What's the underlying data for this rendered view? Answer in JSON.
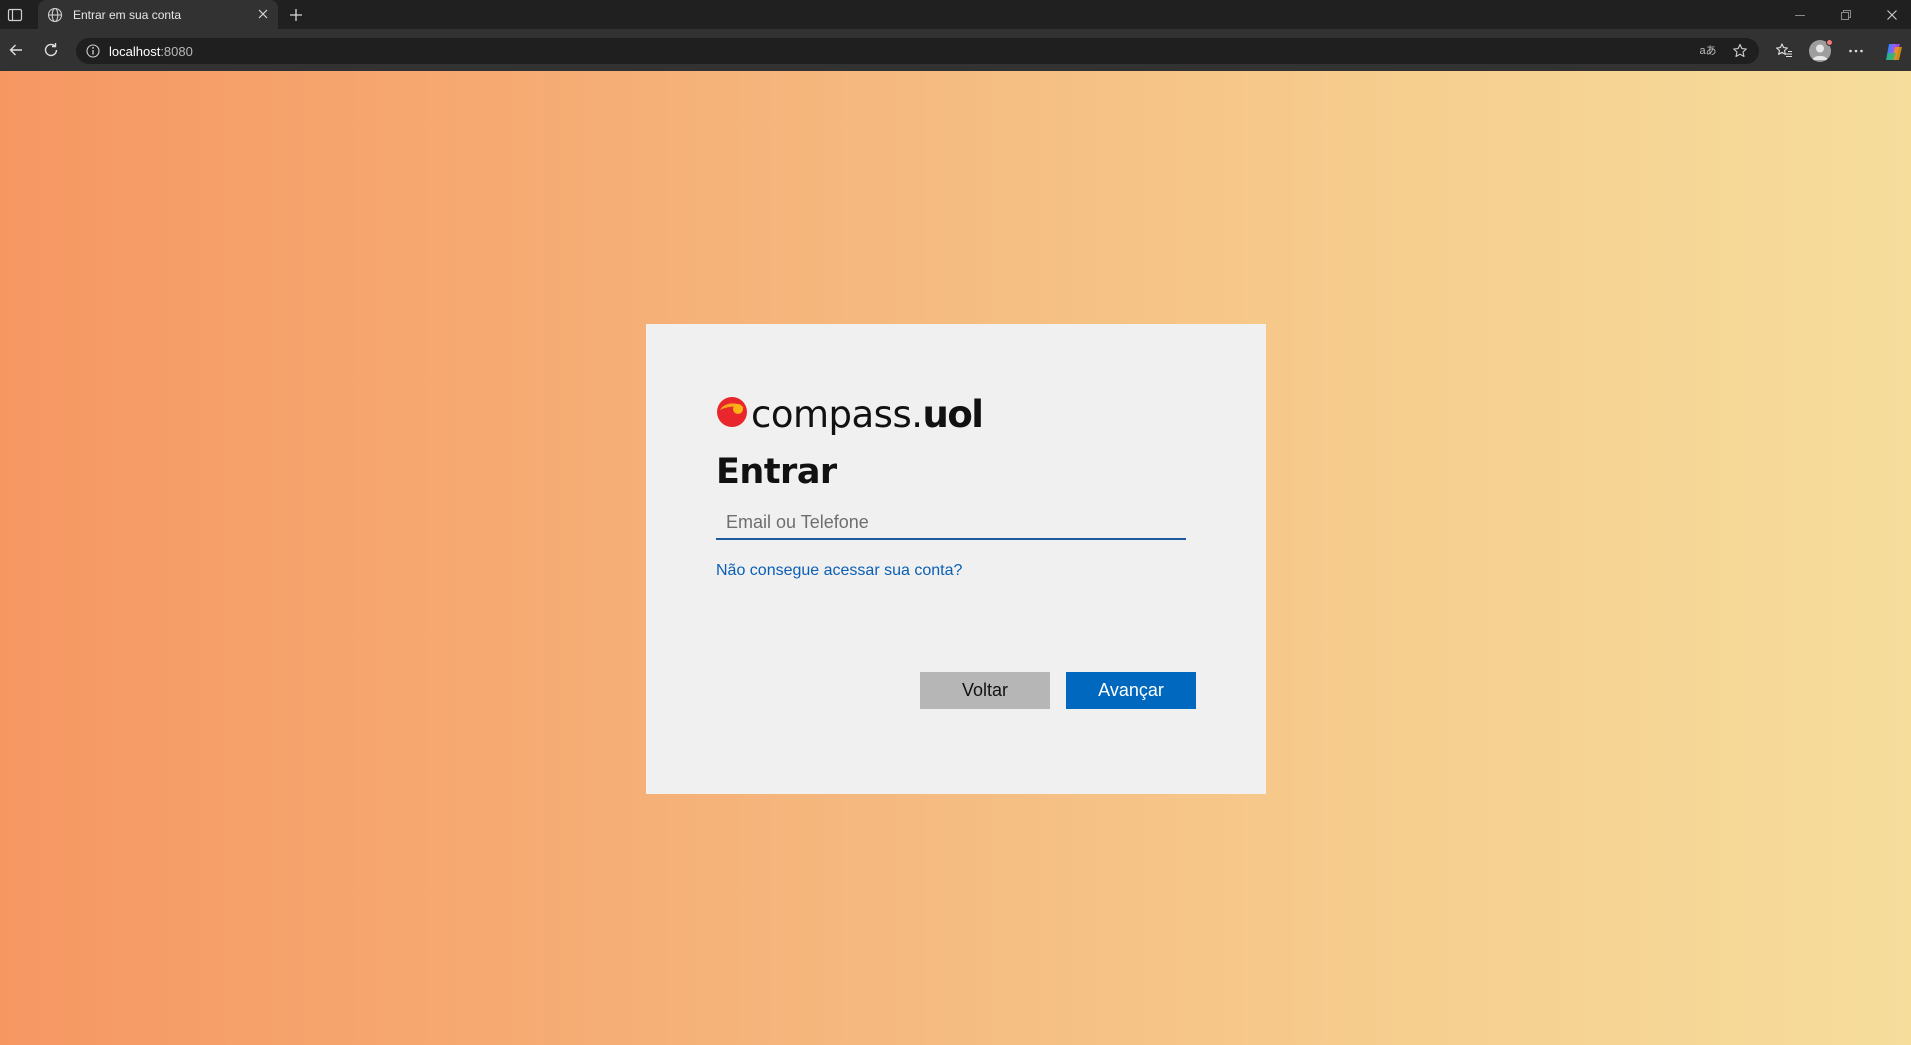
{
  "browser": {
    "tab_title": "Entrar em sua conta",
    "url_host": "localhost",
    "url_port": ":8080",
    "read_aloud_glyph": "aあ",
    "icons": {
      "tab_actions": "tab-actions-icon",
      "favicon": "globe-icon",
      "tab_close": "close-icon",
      "new_tab": "plus-icon",
      "back": "back-arrow-icon",
      "refresh": "refresh-icon",
      "site_info": "info-icon",
      "favorite": "star-icon",
      "favorites": "favorites-icon",
      "profile": "profile-icon",
      "menu": "more-icon",
      "copilot": "copilot-icon",
      "minimize": "minimize-icon",
      "restore": "restore-icon",
      "close_window": "close-icon"
    }
  },
  "page": {
    "logo": {
      "word_main": "compass",
      "word_dot": ".",
      "word_bold": "uol",
      "mark_colors": [
        "#e8262c",
        "#f7a51c",
        "#fcd34d"
      ]
    },
    "title": "Entrar",
    "email_input": {
      "value": "",
      "placeholder": "Email ou Telefone"
    },
    "help_link": "Não consegue acessar sua conta?",
    "buttons": {
      "back_label": "Voltar",
      "next_label": "Avançar"
    },
    "colors": {
      "primary": "#0068be",
      "link": "#0a5fb6",
      "secondary_button": "#b6b6b6",
      "card": "#f0f0f0",
      "gradient_start": "#f69762",
      "gradient_end": "#f6dd9c"
    }
  }
}
